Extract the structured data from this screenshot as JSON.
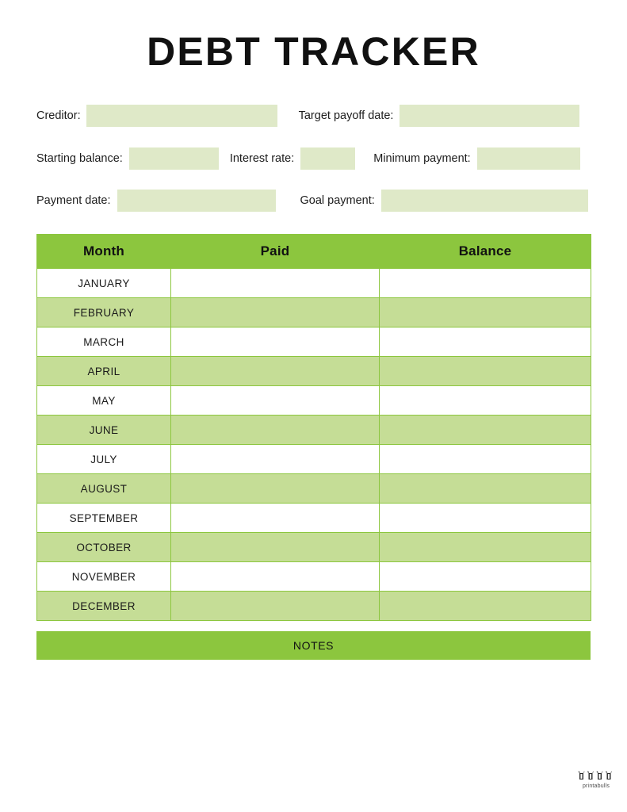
{
  "document": {
    "title": "DEBT TRACKER"
  },
  "form": {
    "rows": [
      {
        "fields": [
          {
            "label": "Creditor:",
            "value": ""
          },
          {
            "label": "Target payoff date:",
            "value": ""
          }
        ]
      },
      {
        "fields": [
          {
            "label": "Starting balance:",
            "value": ""
          },
          {
            "label": "Interest rate:",
            "value": ""
          },
          {
            "label": "Minimum payment:",
            "value": ""
          }
        ]
      },
      {
        "fields": [
          {
            "label": "Payment date:",
            "value": ""
          },
          {
            "label": "Goal payment:",
            "value": ""
          }
        ]
      }
    ]
  },
  "table": {
    "headers": [
      "Month",
      "Paid",
      "Balance"
    ],
    "rows": [
      {
        "month": "JANUARY",
        "paid": "",
        "balance": ""
      },
      {
        "month": "FEBRUARY",
        "paid": "",
        "balance": ""
      },
      {
        "month": "MARCH",
        "paid": "",
        "balance": ""
      },
      {
        "month": "APRIL",
        "paid": "",
        "balance": ""
      },
      {
        "month": "MAY",
        "paid": "",
        "balance": ""
      },
      {
        "month": "JUNE",
        "paid": "",
        "balance": ""
      },
      {
        "month": "JULY",
        "paid": "",
        "balance": ""
      },
      {
        "month": "AUGUST",
        "paid": "",
        "balance": ""
      },
      {
        "month": "SEPTEMBER",
        "paid": "",
        "balance": ""
      },
      {
        "month": "OCTOBER",
        "paid": "",
        "balance": ""
      },
      {
        "month": "NOVEMBER",
        "paid": "",
        "balance": ""
      },
      {
        "month": "DECEMBER",
        "paid": "",
        "balance": ""
      }
    ]
  },
  "notes": {
    "label": "NOTES"
  },
  "footer": {
    "logo_caption": "printabulls",
    "logo_icon": "bulls-icon"
  },
  "colors": {
    "header_green": "#8cc63e",
    "row_green": "#c5dd96",
    "field_green": "#dfe9c8",
    "text": "#1a1a1a",
    "page_background": "#ffffff"
  }
}
